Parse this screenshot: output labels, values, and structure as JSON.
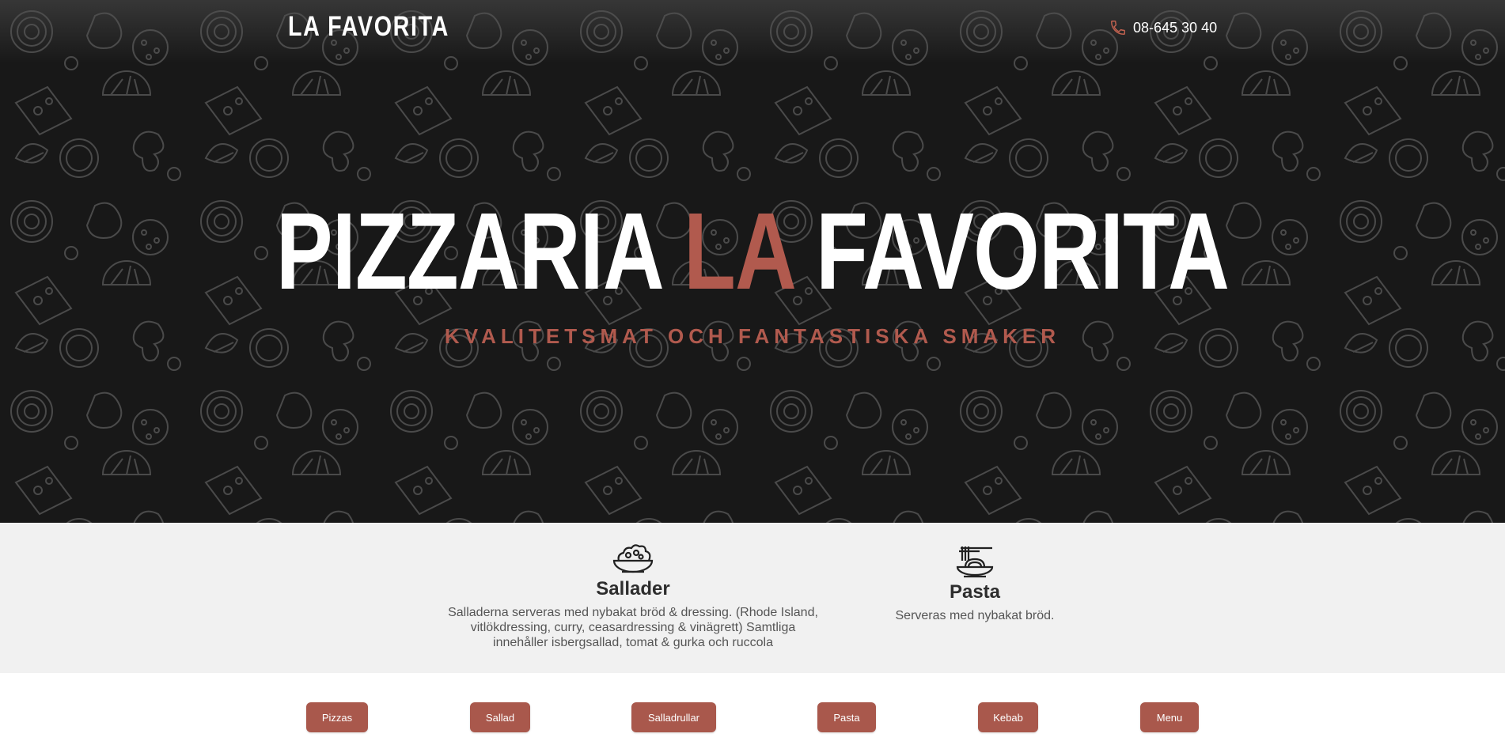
{
  "header": {
    "brand": "LA FAVORITA",
    "phone": "08-645 30 40",
    "phone_icon": "phone-icon"
  },
  "hero": {
    "title_part1": "PIZZARIA",
    "title_accent": "LA",
    "title_part2": "FAVORITA",
    "subtitle": "KVALITETSMAT OCH FANTASTISKA SMAKER"
  },
  "categories": [
    {
      "icon": "salad-bowl-icon",
      "title": "Sallader",
      "description": "Salladerna serveras med nybakat bröd & dressing. (Rhode Island, vitlökdressing, curry, ceasardressing & vinägrett) Samtliga innehåller isbergsallad, tomat & gurka och ruccola"
    },
    {
      "icon": "pasta-plate-icon",
      "title": "Pasta",
      "description": "Serveras med nybakat bröd."
    }
  ],
  "nav_buttons": [
    "Pizzas",
    "Sallad",
    "Salladrullar",
    "Pasta",
    "Kebab",
    "Menu"
  ],
  "colors": {
    "accent": "#b15a4e",
    "button": "#a9584c",
    "hero_bg": "#181818",
    "section_bg": "#f1f1f1"
  }
}
